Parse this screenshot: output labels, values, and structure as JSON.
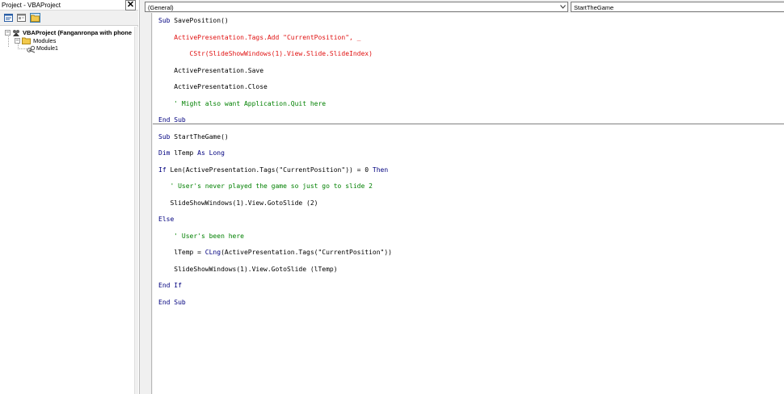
{
  "project_explorer": {
    "title": "Project - VBAProject",
    "close_label": "✕",
    "toolbar": {
      "view_code_icon": "view-code-icon",
      "view_object_icon": "view-object-icon",
      "toggle_folders_icon": "toggle-folders-icon"
    },
    "tree": {
      "project": {
        "label": "VBAProject (Fanganronpa with phone",
        "expander": "−"
      },
      "modules_folder": {
        "label": "Modules",
        "expander": "−"
      },
      "module": {
        "label": "Module1"
      }
    }
  },
  "code_window": {
    "object_combo": {
      "value": "(General)"
    },
    "procedure_combo": {
      "value": "StartTheGame"
    },
    "lines": [
      [
        {
          "t": "Sub ",
          "c": "kw"
        },
        {
          "t": "SavePosition()",
          "c": ""
        }
      ],
      [
        {
          "t": "    ActivePresentation.Tags.Add \"CurrentPosition\", _",
          "c": "err"
        }
      ],
      [
        {
          "t": "        CStr(SlideShowWindows(1).View.Slide.SlideIndex)",
          "c": "err"
        }
      ],
      [
        {
          "t": "    ActivePresentation.Save",
          "c": ""
        }
      ],
      [
        {
          "t": "    ActivePresentation.Close",
          "c": ""
        }
      ],
      [
        {
          "t": "    ' Might also want Application.Quit here",
          "c": "cm"
        }
      ],
      [
        {
          "t": "End Sub",
          "c": "kw"
        }
      ],
      [
        {
          "t": "Sub ",
          "c": "kw"
        },
        {
          "t": "StartTheGame()",
          "c": ""
        }
      ],
      [
        {
          "t": "Dim ",
          "c": "kw"
        },
        {
          "t": "lTemp ",
          "c": ""
        },
        {
          "t": "As Long",
          "c": "kw"
        }
      ],
      [
        {
          "t": "If ",
          "c": "kw"
        },
        {
          "t": "Len(ActivePresentation.Tags(\"CurrentPosition\")) = 0 ",
          "c": ""
        },
        {
          "t": "Then",
          "c": "kw"
        }
      ],
      [
        {
          "t": "   ' User's never played the game so just go to slide 2",
          "c": "cm"
        }
      ],
      [
        {
          "t": "   SlideShowWindows(1).View.GotoSlide (2)",
          "c": ""
        }
      ],
      [
        {
          "t": "Else",
          "c": "kw"
        }
      ],
      [
        {
          "t": "    ' User's been here",
          "c": "cm"
        }
      ],
      [
        {
          "t": "    lTemp = ",
          "c": ""
        },
        {
          "t": "CLng",
          "c": "kw"
        },
        {
          "t": "(ActivePresentation.Tags(\"CurrentPosition\"))",
          "c": ""
        }
      ],
      [
        {
          "t": "    SlideShowWindows(1).View.GotoSlide (lTemp)",
          "c": ""
        }
      ],
      [
        {
          "t": "End If",
          "c": "kw"
        }
      ],
      [
        {
          "t": "End Sub",
          "c": "kw"
        }
      ]
    ]
  },
  "colors": {
    "keyword": "#00007f",
    "syntax_error": "#e01010",
    "comment": "#008000"
  }
}
